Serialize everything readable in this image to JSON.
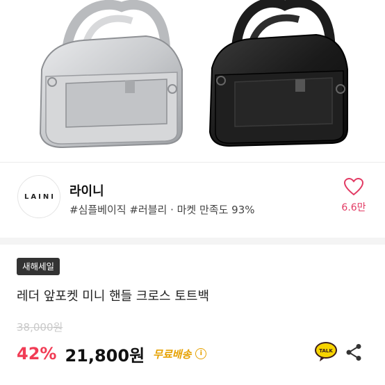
{
  "hero": {
    "alt": "silver and black mini handle bags"
  },
  "brand": {
    "logo_text": "LAINI",
    "name": "라이니",
    "tags": "#심플베이직 #러블리 · 마켓 만족도 93%",
    "likes": "6.6만"
  },
  "product": {
    "badge": "새해세일",
    "title": "레더 앞포켓 미니 핸들 크로스 토트백",
    "original_price": "38,000원",
    "discount": "42%",
    "price": "21,800원",
    "shipping": "무료배송",
    "talk_label": "TALK"
  },
  "colors": {
    "accent_pink": "#f13c55",
    "shipping_yellow": "#e6a100",
    "badge_dark": "#333333"
  }
}
